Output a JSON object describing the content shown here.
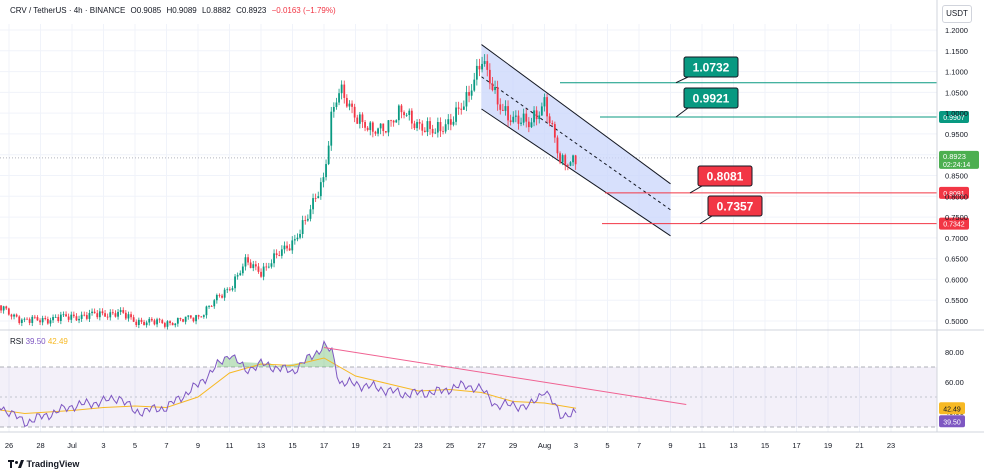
{
  "header": {
    "symbol": "CRV / TetherUS · 4h · BINANCE",
    "open": "O0.9085",
    "high": "H0.9089",
    "low": "L0.8882",
    "close": "C0.8923",
    "change": "−0.0163 (−1.79%)"
  },
  "currency_button": "USDT",
  "rsi": {
    "label": "RSI",
    "value": "39.50",
    "ma_value": "42.49"
  },
  "branding": {
    "logo_text": "TradingView"
  },
  "colors": {
    "up": "#089981",
    "down": "#f23645",
    "channel_fill": "#c9d6fb",
    "channel_line": "#131722",
    "resistance": "#089981",
    "support": "#f23645",
    "rsi_line": "#7e57c2",
    "rsi_ma": "#f7b924",
    "rsi_trend": "#f06292",
    "current_price_bg": "#4caf50"
  },
  "chart_data": [
    {
      "type": "candlestick",
      "title": "CRV / TetherUS · 4h · BINANCE",
      "x_tick_labels": [
        "26",
        "28",
        "Jul",
        "3",
        "5",
        "7",
        "9",
        "11",
        "13",
        "15",
        "17",
        "19",
        "21",
        "23",
        "25",
        "27",
        "29",
        "Aug",
        "3",
        "5",
        "7",
        "9",
        "11",
        "13",
        "15",
        "17",
        "19",
        "21",
        "23"
      ],
      "y_tick_labels": [
        "1.2000",
        "1.1500",
        "1.1000",
        "1.0500",
        "1.0000",
        "0.9500",
        "0.9000",
        "0.8500",
        "0.8000",
        "0.7500",
        "0.7000",
        "0.6500",
        "0.6000",
        "0.5500",
        "0.5000"
      ],
      "ylim": [
        0.47,
        1.215
      ],
      "grid": true,
      "close_path": {
        "dates": [
          "Jun 25",
          "Jun 27",
          "Jul 1",
          "Jul 4",
          "Jul 5",
          "Jul 7",
          "Jul 9",
          "Jul 11",
          "Jul 12",
          "Jul 13",
          "Jul 15",
          "Jul 16",
          "Jul 17",
          "Jul 17.5",
          "Jul 18",
          "Jul 20",
          "Jul 22",
          "Jul 24",
          "Jul 26",
          "Jul 27",
          "Jul 28",
          "Jul 29",
          "Jul 30",
          "Jul 31",
          "Aug 1",
          "Aug 2"
        ],
        "close": [
          0.54,
          0.5,
          0.51,
          0.52,
          0.5,
          0.495,
          0.51,
          0.58,
          0.64,
          0.62,
          0.69,
          0.75,
          0.85,
          1.0,
          1.05,
          0.95,
          1.0,
          0.95,
          1.02,
          1.14,
          1.02,
          0.99,
          0.97,
          1.03,
          0.88,
          0.8923
        ]
      },
      "descending_channel": {
        "upper_start": {
          "x": "Jul 27",
          "y": 1.165
        },
        "upper_end": {
          "x": "Aug 8",
          "y": 0.83
        },
        "lower_start": {
          "x": "Jul 27",
          "y": 1.01
        },
        "lower_end": {
          "x": "Aug 8",
          "y": 0.705
        }
      },
      "levels": [
        {
          "price": 1.0732,
          "label": "1.0732",
          "kind": "resistance"
        },
        {
          "price": 0.9907,
          "label": "0.9921",
          "axis_label": "0.9907",
          "kind": "resistance"
        },
        {
          "price": 0.8081,
          "label": "0.8081",
          "axis_label": "0.8081",
          "kind": "support"
        },
        {
          "price": 0.7342,
          "label": "0.7357",
          "axis_label": "0.7342",
          "kind": "support"
        }
      ],
      "current_price": {
        "value": "0.8923",
        "countdown": "02:24:14"
      }
    },
    {
      "type": "line",
      "title": "RSI",
      "y_tick_labels": [
        "80.00",
        "60.00",
        "40.00"
      ],
      "ylim": [
        18,
        88
      ],
      "bands": [
        70,
        50,
        30
      ],
      "rsi_value": 39.5,
      "ma_value": 42.49,
      "rsi_path": {
        "dates": [
          "Jun 25",
          "Jun 26",
          "Jun 27",
          "Jun 29",
          "Jul 1",
          "Jul 3",
          "Jul 4",
          "Jul 5",
          "Jul 7",
          "Jul 9",
          "Jul 11",
          "Jul 12",
          "Jul 13",
          "Jul 15",
          "Jul 17",
          "Jul 17.5",
          "Jul 18",
          "Jul 20",
          "Jul 22",
          "Jul 24",
          "Jul 26",
          "Jul 27",
          "Jul 28",
          "Jul 29",
          "Jul 30",
          "Jul 31",
          "Aug 1",
          "Aug 2"
        ],
        "values": [
          47,
          40,
          33,
          40,
          44,
          47,
          50,
          40,
          43,
          58,
          79,
          68,
          72,
          67,
          84,
          80,
          60,
          57,
          52,
          53,
          58,
          55,
          44,
          45,
          43,
          55,
          38,
          39.5
        ]
      },
      "ma_path": {
        "dates": [
          "Jun 25",
          "Jun 27",
          "Jul 1",
          "Jul 3",
          "Jul 5",
          "Jul 7",
          "Jul 9",
          "Jul 11",
          "Jul 13",
          "Jul 15",
          "Jul 17",
          "Jul 19",
          "Jul 21",
          "Jul 23",
          "Jul 25",
          "Jul 27",
          "Jul 29",
          "Jul 31",
          "Aug 2"
        ],
        "values": [
          42,
          39,
          41,
          43,
          44,
          43,
          50,
          66,
          72,
          71,
          76,
          64,
          59,
          54,
          55,
          53,
          47,
          46,
          42.49
        ]
      },
      "trendline": {
        "start": {
          "x": "Jul 17",
          "y": 83
        },
        "end": {
          "x": "Aug 9",
          "y": 45
        }
      }
    }
  ]
}
